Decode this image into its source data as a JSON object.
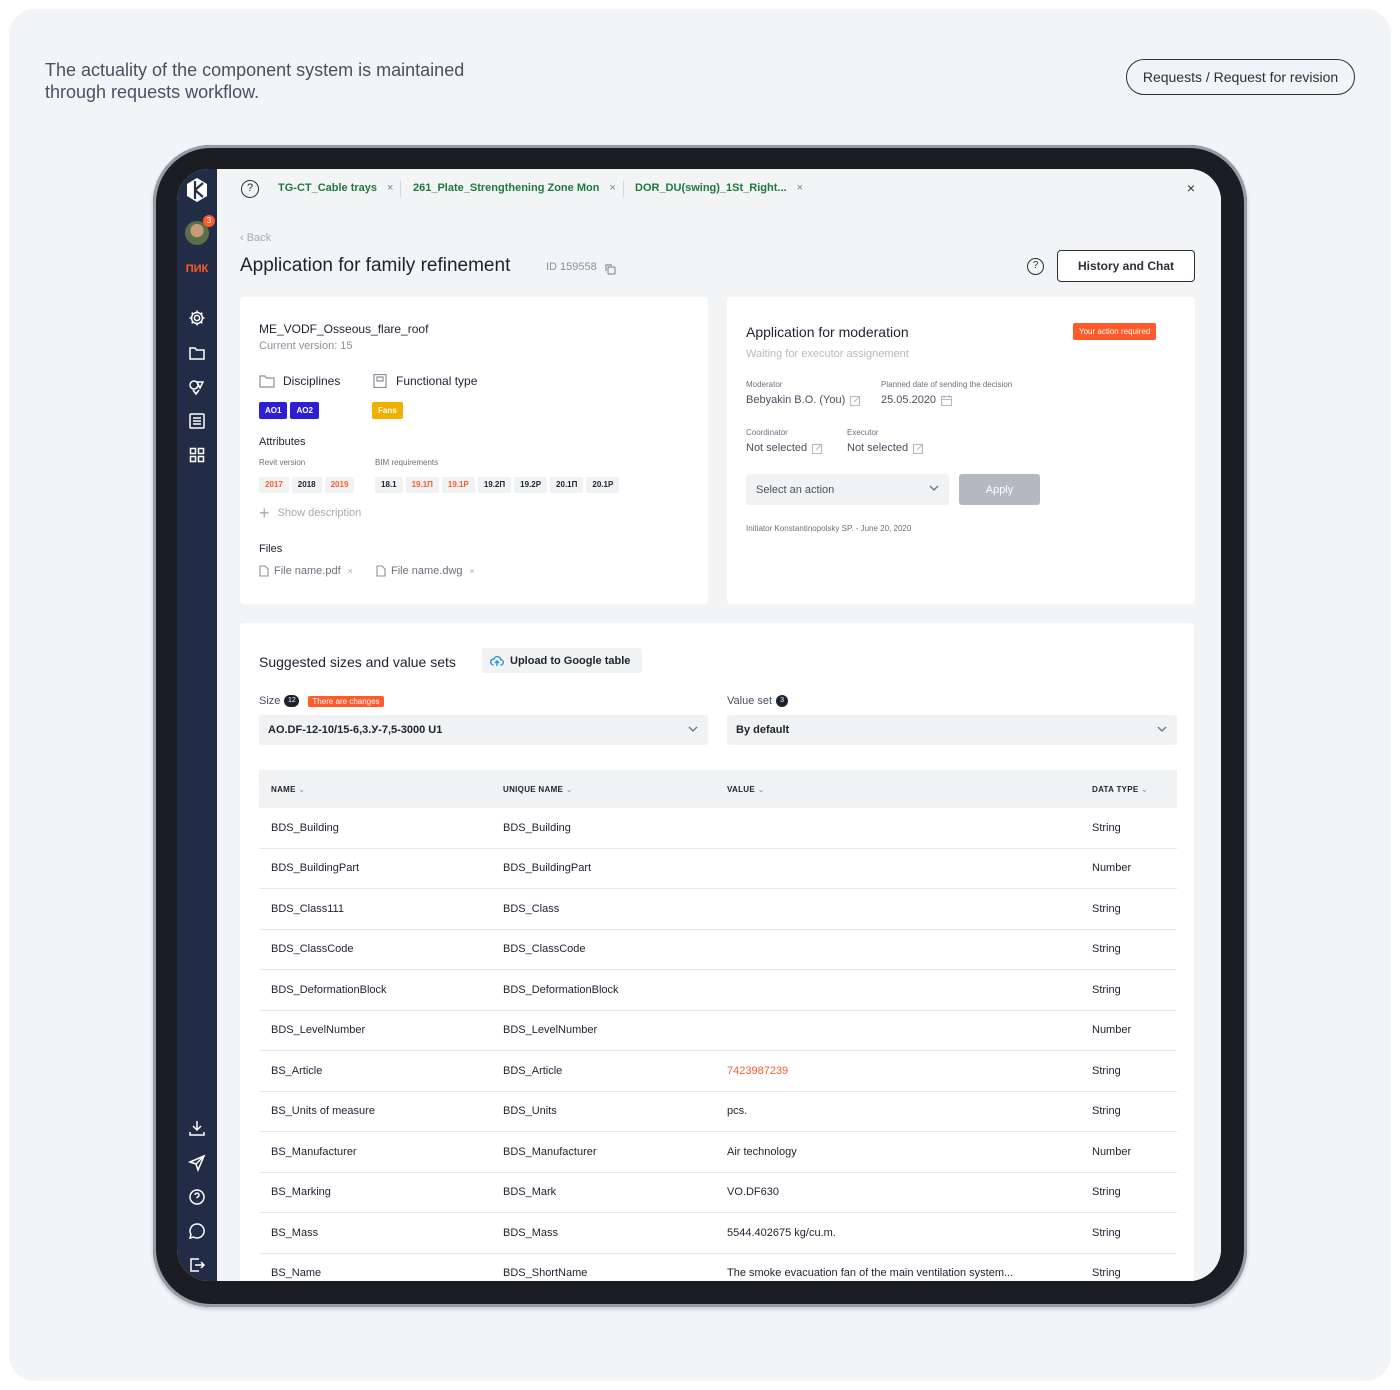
{
  "caption": "The actuality of the component system is maintained through requests workflow.",
  "breadcrumb": "Requests / Request for revision",
  "sidebar": {
    "brand": "ПИК",
    "notifications": "3"
  },
  "tabs": [
    {
      "label": "TG-CT_Cable trays"
    },
    {
      "label": "261_Plate_Strengthening Zone Mon"
    },
    {
      "label": "DOR_DU(swing)_1St_Right..."
    }
  ],
  "tab_close": "×",
  "header": {
    "back": "‹ Back",
    "title": "Application for family refinement",
    "id": "ID 159558",
    "help": "?",
    "history_button": "History and Chat"
  },
  "family": {
    "name": "ME_VODF_Osseous_flare_roof",
    "version": "Current version: 15",
    "disciplines_label": "Disciplines",
    "disciplines": [
      "AO1",
      "AO2"
    ],
    "functional_type_label": "Functional type",
    "functional_type": "Fans",
    "attributes_label": "Attributes",
    "revit_label": "Revit version",
    "revit_versions": [
      {
        "v": "2017",
        "hl": true
      },
      {
        "v": "2018",
        "hl": false
      },
      {
        "v": "2019",
        "hl": true
      }
    ],
    "bim_label": "BIM requirements",
    "bim_versions": [
      {
        "v": "18.1",
        "hl": false
      },
      {
        "v": "19.1П",
        "hl": true
      },
      {
        "v": "19.1Р",
        "hl": true
      },
      {
        "v": "19.2П",
        "hl": false
      },
      {
        "v": "19.2Р",
        "hl": false
      },
      {
        "v": "20.1П",
        "hl": false
      },
      {
        "v": "20.1Р",
        "hl": false
      }
    ],
    "show_description": "Show description",
    "files_label": "Files",
    "files": [
      "File name.pdf",
      "File name.dwg"
    ]
  },
  "moderation": {
    "title": "Application for moderation",
    "badge": "Your action required",
    "status": "Waiting for executor assignement",
    "moderator_label": "Moderator",
    "moderator": "Bebyakin B.O. (You)",
    "planned_label": "Planned date of sending the decision",
    "planned": "25.05.2020",
    "coordinator_label": "Coordinator",
    "coordinator": "Not selected",
    "executor_label": "Executor",
    "executor": "Not selected",
    "action_placeholder": "Select an action",
    "apply": "Apply",
    "initiator": "Initiator Konstantinopolsky SP. - June 20, 2020"
  },
  "sizes": {
    "title": "Suggested sizes and value sets",
    "upload": "Upload to Google table",
    "size_label": "Size",
    "size_count": "12",
    "changes": "There are changes",
    "size_value": "AO.DF-12-10/15-6,3.У-7,5-3000 U1",
    "valueset_label": "Value set",
    "valueset_count": "3",
    "valueset_value": "By default"
  },
  "table": {
    "headers": [
      "NAME",
      "UNIQUE NAME",
      "VALUE",
      "DATA TYPE"
    ],
    "rows": [
      [
        "BDS_Building",
        "BDS_Building",
        "",
        "String"
      ],
      [
        "BDS_BuildingPart",
        "BDS_BuildingPart",
        "",
        "Number"
      ],
      [
        "BDS_Class111",
        "BDS_Class",
        "",
        "String"
      ],
      [
        "BDS_ClassCode",
        "BDS_ClassCode",
        "",
        "String"
      ],
      [
        "BDS_DeformationBlock",
        "BDS_DeformationBlock",
        "",
        "String"
      ],
      [
        "BDS_LevelNumber",
        "BDS_LevelNumber",
        "",
        "Number"
      ],
      [
        "BS_Article",
        "BDS_Article",
        "7423987239",
        "String"
      ],
      [
        "BS_Units of measure",
        "BDS_Units",
        "pcs.",
        "String"
      ],
      [
        "BS_Manufacturer",
        "BDS_Manufacturer",
        "Air technology",
        "Number"
      ],
      [
        "BS_Marking",
        "BDS_Mark",
        "VO.DF630",
        "String"
      ],
      [
        "BS_Mass",
        "BDS_Mass",
        "5544.402675 kg/cu.m.",
        "String"
      ],
      [
        "BS_Name",
        "BDS_ShortName",
        "The smoke evacuation fan of the main ventilation system...",
        "String"
      ]
    ],
    "accent_row": 6
  },
  "colors": {
    "accent": "#ff5a2a",
    "sidebar": "#232c47",
    "tab_text": "#1e7a3c",
    "chip_blue": "#2e1fd4",
    "chip_yellow": "#f0b000"
  }
}
